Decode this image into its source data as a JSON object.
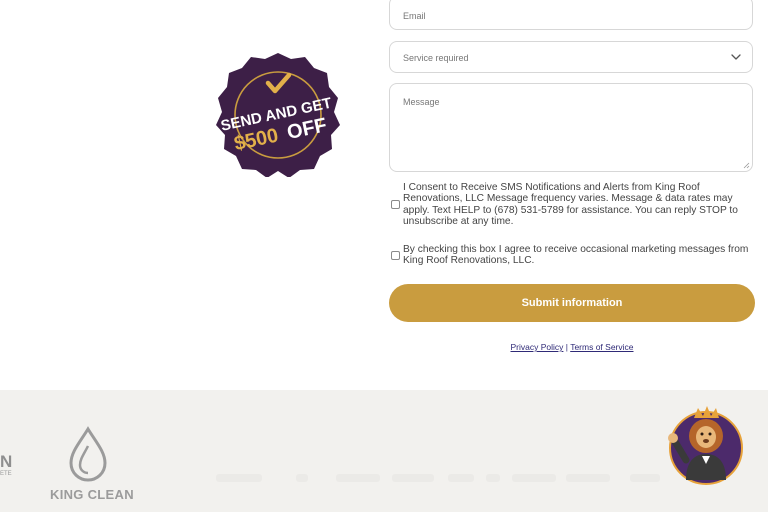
{
  "form": {
    "email_placeholder": "Email",
    "service_placeholder": "Service required",
    "message_placeholder": "Message",
    "consent_sms": "I Consent to Receive SMS Notifications and Alerts from King Roof Renovations, LLC Message frequency varies. Message & data rates may apply. Text HELP to (678) 531-5789 for assistance. You can reply STOP to unsubscribe at any time.",
    "consent_marketing": "By checking this box I agree to receive occasional marketing messages from King Roof Renovations, LLC.",
    "submit_label": "Submit information",
    "privacy_label": "Privacy Policy",
    "separator": "|",
    "terms_label": "Terms of Service"
  },
  "badge": {
    "line1": "SEND AND GET",
    "line2_amount": "$500",
    "line2_off": "OFF"
  },
  "footer": {
    "partial_logo": "N",
    "partial_logo_sub": "ETE",
    "king_clean_label": "KING CLEAN"
  },
  "colors": {
    "accent_gold": "#c99c3f",
    "badge_purple": "#3d1f47",
    "link_blue": "#2f2a77",
    "footer_bg": "#f2f1ee"
  },
  "icons": {
    "service_dropdown": "chevron-down-icon",
    "badge_check": "check-icon",
    "mascot": "lion-mascot-icon"
  }
}
